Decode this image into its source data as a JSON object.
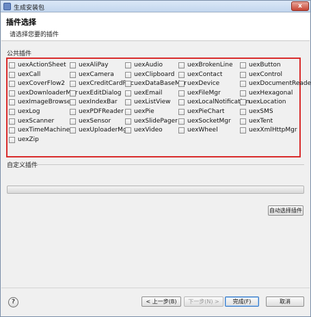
{
  "window": {
    "title": "生成安装包",
    "close_label": "x"
  },
  "header": {
    "title": "插件选择",
    "subtitle": "请选择您要的插件"
  },
  "public_plugins": {
    "label": "公共插件",
    "items": [
      "uexActionSheet",
      "uexAliPay",
      "uexAudio",
      "uexBrokenLine",
      "uexButton",
      "uexCall",
      "uexCamera",
      "uexClipboard",
      "uexContact",
      "uexControl",
      "uexCoverFlow2",
      "uexCreditCardRec",
      "uexDataBaseMgr",
      "uexDevice",
      "uexDocumentReader",
      "uexDownloaderMgr",
      "uexEditDialog",
      "uexEmail",
      "uexFileMgr",
      "uexHexagonal",
      "uexImageBrowser",
      "uexIndexBar",
      "uexListView",
      "uexLocalNotification",
      "uexLocation",
      "uexLog",
      "uexPDFReader",
      "uexPie",
      "uexPieChart",
      "uexSMS",
      "uexScanner",
      "uexSensor",
      "uexSlidePager",
      "uexSocketMgr",
      "uexTent",
      "uexTimeMachine",
      "uexUploaderMgr",
      "uexVideo",
      "uexWheel",
      "uexXmlHttpMgr",
      "uexZip"
    ]
  },
  "custom_plugins": {
    "label": "自定义插件"
  },
  "actions": {
    "auto_select": "自动选择插件",
    "back": "< 上一步(B)",
    "next": "下一步(N) >",
    "finish": "完成(F)",
    "cancel": "取消"
  },
  "icons": {
    "help": "help-icon",
    "app": "app-icon",
    "close": "close-icon"
  },
  "colors": {
    "highlight_border": "#d82b2b"
  }
}
